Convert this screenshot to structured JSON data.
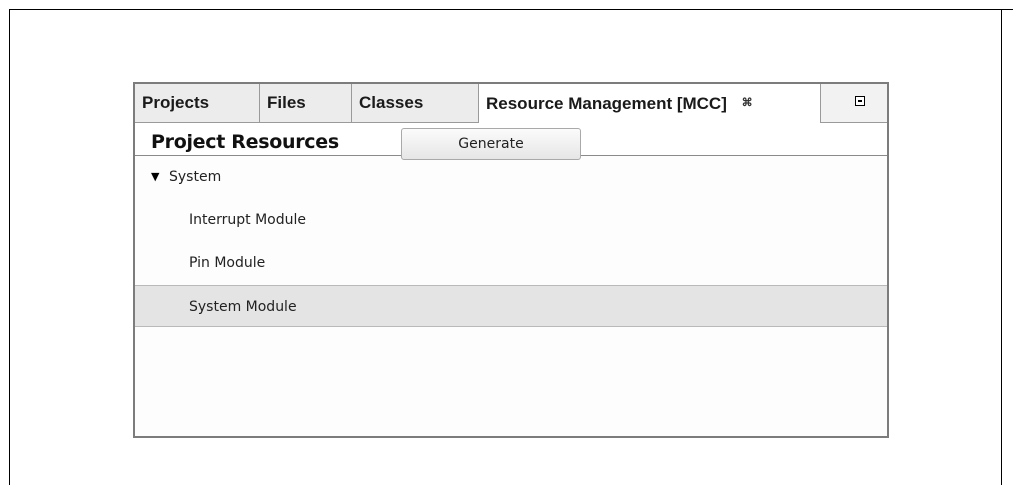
{
  "tabs": [
    {
      "label": "Projects"
    },
    {
      "label": "Files"
    },
    {
      "label": "Classes"
    },
    {
      "label": "Resource Management [MCC]",
      "active": true,
      "close_glyph": "⌘"
    }
  ],
  "toolbar": {
    "title": "Project Resources",
    "generate_label": "Generate"
  },
  "tree": {
    "root": {
      "label": "System",
      "expanded": true,
      "expander_glyph": "▼"
    },
    "children": [
      {
        "label": "Interrupt Module"
      },
      {
        "label": "Pin Module"
      },
      {
        "label": "System Module",
        "selected": true
      }
    ]
  },
  "icons": {
    "minimize": "minimize-icon",
    "tab_close": "close-icon",
    "expander": "triangle-down-icon"
  }
}
